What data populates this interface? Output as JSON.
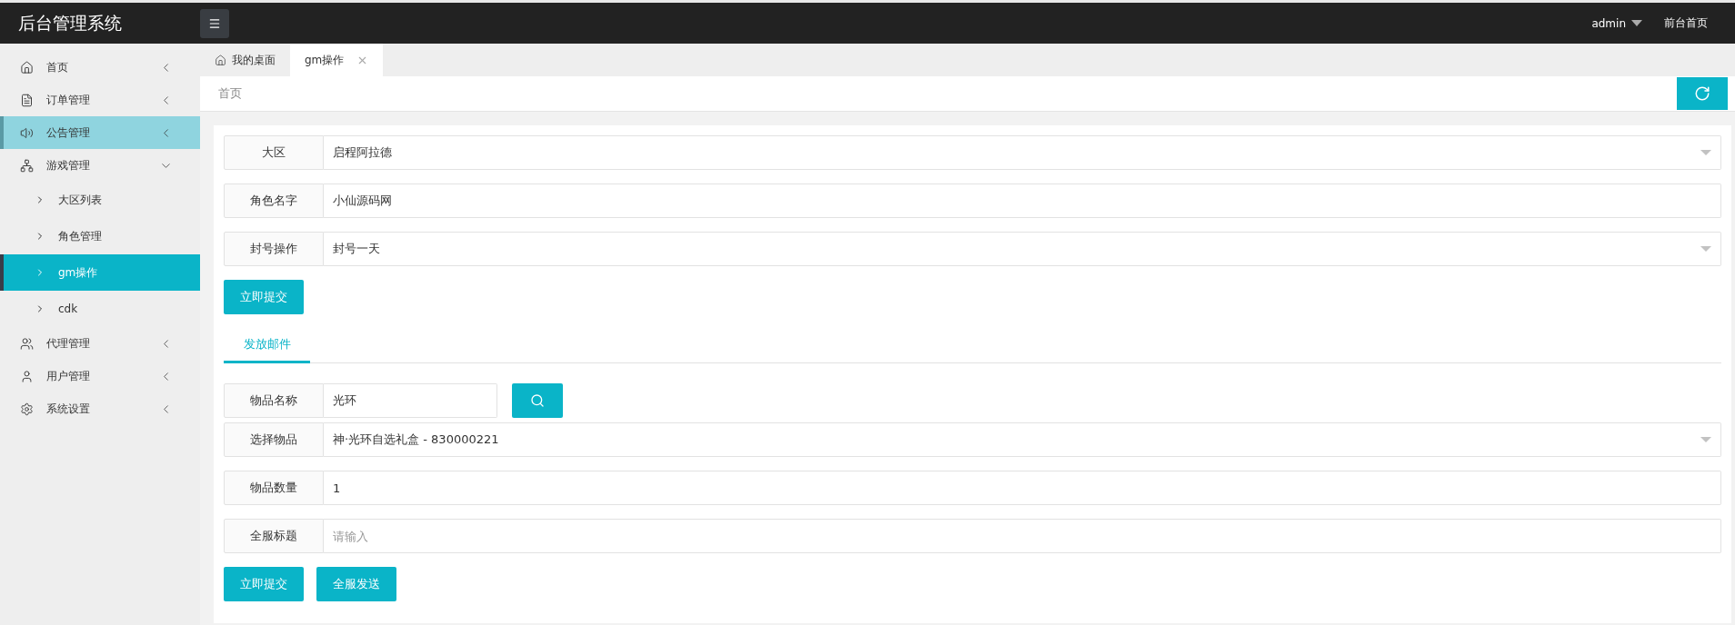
{
  "header": {
    "title": "后台管理系统",
    "user": "admin",
    "front_link": "前台首页"
  },
  "sidebar": {
    "items": [
      {
        "label": "首页",
        "expanded": false,
        "hovered": false
      },
      {
        "label": "订单管理",
        "expanded": false,
        "hovered": false
      },
      {
        "label": "公告管理",
        "expanded": false,
        "hovered": true
      },
      {
        "label": "游戏管理",
        "expanded": true,
        "hovered": false,
        "children": [
          {
            "label": "大区列表",
            "selected": false
          },
          {
            "label": "角色管理",
            "selected": false
          },
          {
            "label": "gm操作",
            "selected": true
          },
          {
            "label": "cdk",
            "selected": false
          }
        ]
      },
      {
        "label": "代理管理",
        "expanded": false,
        "hovered": false
      },
      {
        "label": "用户管理",
        "expanded": false,
        "hovered": false
      },
      {
        "label": "系统设置",
        "expanded": false,
        "hovered": false
      }
    ]
  },
  "tabs": [
    {
      "label": "我的桌面",
      "kind": "home",
      "selected": false
    },
    {
      "label": "gm操作",
      "kind": "closable",
      "selected": true
    }
  ],
  "breadcrumb": "首页",
  "ban_form": {
    "fields": [
      {
        "label": "大区",
        "kind": "select",
        "value": "启程阿拉德"
      },
      {
        "label": "角色名字",
        "kind": "input",
        "value": "小仙源码网"
      },
      {
        "label": "封号操作",
        "kind": "select",
        "value": "封号一天"
      }
    ],
    "buttons": [
      "立即提交"
    ]
  },
  "mail_tabs": [
    {
      "label": "发放邮件",
      "selected": true
    }
  ],
  "mail_form": {
    "fields": [
      {
        "label": "物品名称",
        "kind": "search",
        "value": "光环"
      },
      {
        "label": "选择物品",
        "kind": "select",
        "value": "神·光环自选礼盒 - 830000221"
      },
      {
        "label": "物品数量",
        "kind": "input",
        "value": "1"
      },
      {
        "label": "全服标题",
        "kind": "input",
        "placeholder": "请输入"
      }
    ],
    "buttons": [
      "立即提交",
      "全服发送"
    ]
  }
}
